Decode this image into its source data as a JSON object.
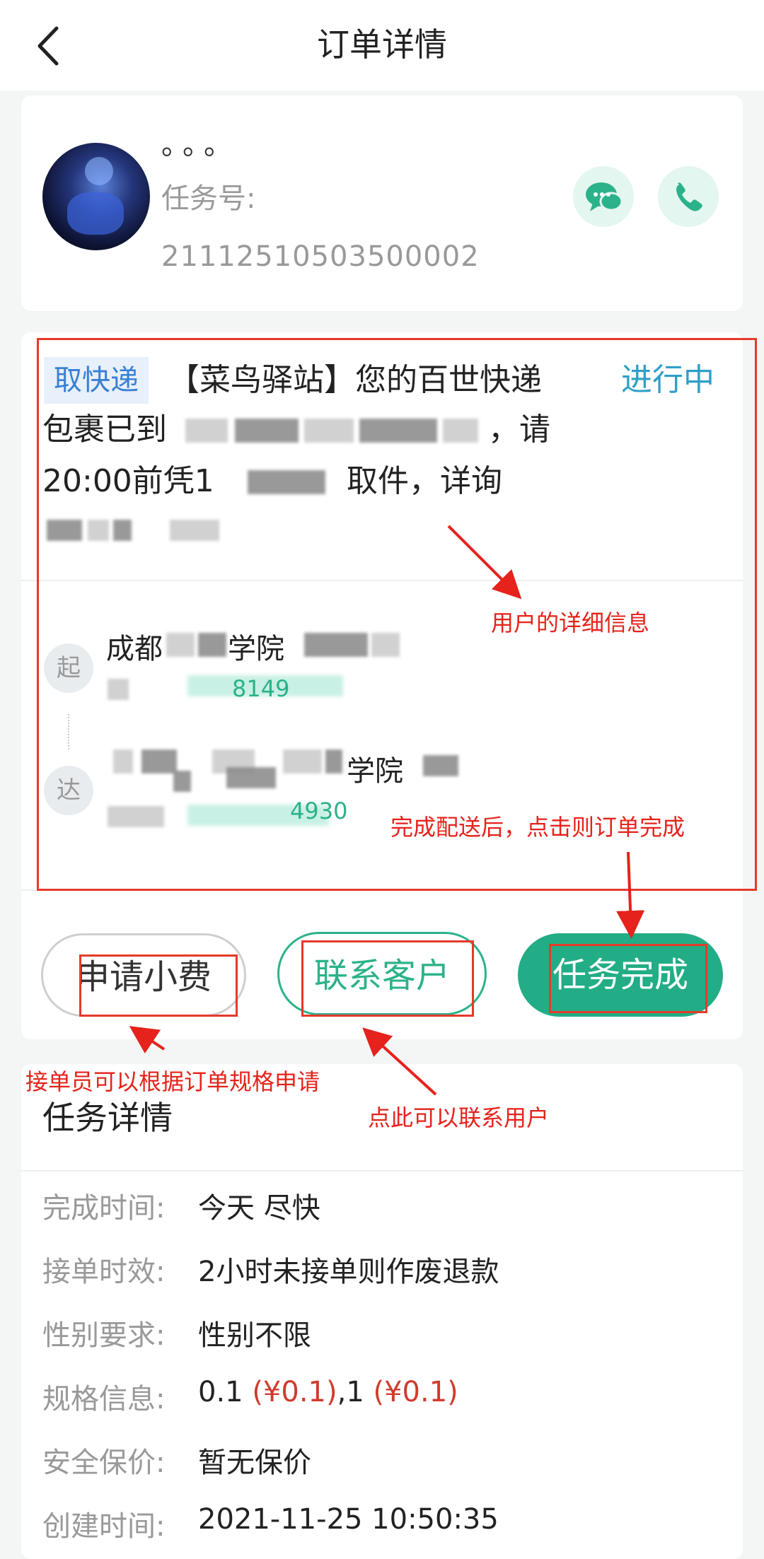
{
  "header": {
    "title": "订单详情"
  },
  "user": {
    "name": "。。。",
    "task_no_label": "任务号:",
    "task_no": "21112510503500002"
  },
  "order": {
    "type_tag": "取快递",
    "status": "进行中",
    "message_line1": "【菜鸟驿站】您的百世快递",
    "message_line2_prefix": "包裹已到",
    "message_line2_suffix": "，请",
    "message_line3_prefix": "20:00前凭1",
    "message_line3_suffix": "取件，详询",
    "from_badge": "起",
    "from_addr_prefix": "成都",
    "from_addr_suffix": "学院",
    "from_phone_fragment": "8149",
    "to_badge": "达",
    "to_addr_suffix": "学院",
    "to_phone_fragment": "4930"
  },
  "actions": {
    "tip_label": "申请小费",
    "contact_label": "联系客户",
    "complete_label": "任务完成"
  },
  "details": {
    "title": "任务详情",
    "rows": [
      {
        "label": "完成时间:",
        "value": "今天 尽快"
      },
      {
        "label": "接单时效:",
        "value": "2小时未接单则作废退款"
      },
      {
        "label": "性别要求:",
        "value": "性别不限"
      },
      {
        "label": "规格信息:",
        "value_a": "0.1 ",
        "value_b": "(¥0.1)",
        "value_c": ",1 ",
        "value_d": "(¥0.1)"
      },
      {
        "label": "安全保价:",
        "value": "暂无保价"
      },
      {
        "label": "创建时间:",
        "value": "2021-11-25 10:50:35"
      }
    ]
  },
  "annotations": {
    "user_detail": "用户的详细信息",
    "complete_note": "完成配送后，点击则订单完成",
    "tip_note": "接单员可以根据订单规格申请",
    "contact_note": "点此可以联系用户"
  },
  "colors": {
    "accent": "#22ad86",
    "status_blue": "#2f9fc7",
    "annotation_red": "#e5221b"
  }
}
